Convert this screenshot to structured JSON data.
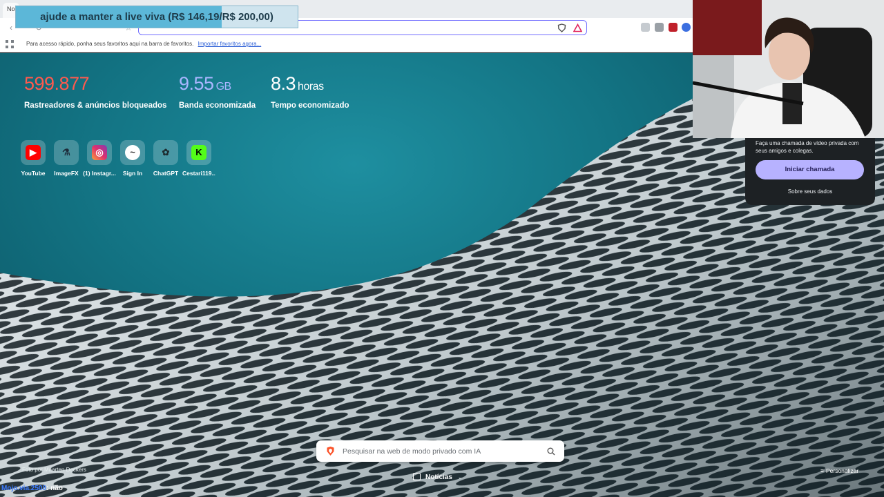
{
  "browser": {
    "tab_label": "No",
    "bookmarks_hint": "Para acesso rápido, ponha seus favoritos aqui na barra de favoritos.",
    "bookmarks_import_link": "Importar favoritos agora..."
  },
  "donation": {
    "text": "ajude a manter a live viva (R$ 146,19/R$ 200,00)",
    "progress": 0.73
  },
  "stats": [
    {
      "value": "599.877",
      "unit": "",
      "label": "Rastreadores & anúncios bloqueados",
      "color": "#ff5a4e"
    },
    {
      "value": "9.55",
      "unit": "GB",
      "label": "Banda economizada",
      "color": "#a9b6ff"
    },
    {
      "value": "8.3",
      "unit": "horas",
      "label": "Tempo economizado",
      "color": "#ffffff"
    }
  ],
  "shortcuts": [
    {
      "label": "YouTube",
      "icon": "youtube-icon"
    },
    {
      "label": "ImageFX",
      "icon": "flask-icon"
    },
    {
      "label": "(1) Instagr...",
      "icon": "instagram-icon"
    },
    {
      "label": "Sign In",
      "icon": "signin-icon"
    },
    {
      "label": "ChatGPT",
      "icon": "chatgpt-icon"
    },
    {
      "label": "Cestari119...",
      "icon": "kick-icon"
    }
  ],
  "search": {
    "placeholder": "Pesquisar na web de modo privado com IA"
  },
  "footer": {
    "photo_credit": "Foto por Maarten Deckers",
    "news_label": "Notícias",
    "customize_label": "Personalizar"
  },
  "call_panel": {
    "description": "Faça uma chamada de vídeo privada com seus amigos e colegas.",
    "start_button": "Iniciar chamada",
    "data_link": "Sobre seus dados"
  },
  "chat": {
    "user": "Mojo.via.2500",
    "message": ": não"
  },
  "colors": {
    "accent": "#6f6cff",
    "brave_orange": "#fb542b",
    "call_button": "#b7b2ff"
  }
}
